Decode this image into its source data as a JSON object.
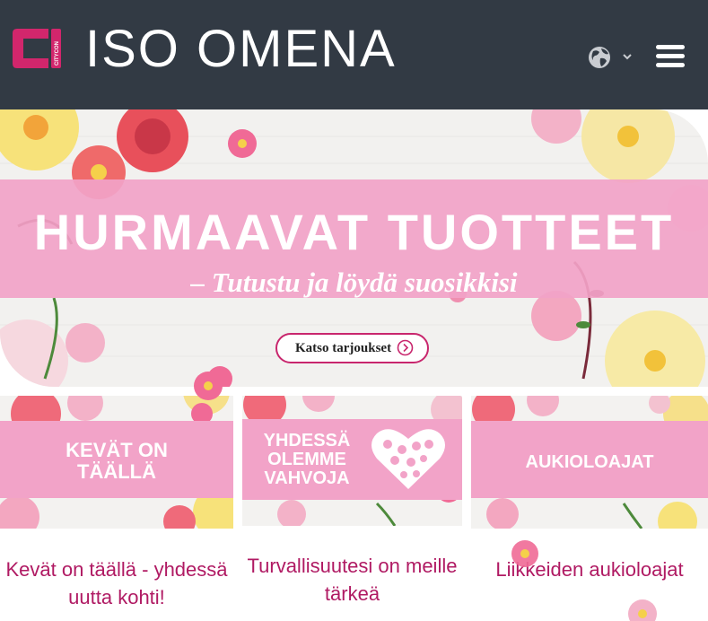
{
  "header": {
    "brand_name": "ISO OMENA",
    "logo_text": "CITYCON",
    "background": "#323a44",
    "icons": {
      "language": "globe-icon",
      "language_caret": "chevron-down-icon",
      "menu": "hamburger-icon"
    }
  },
  "hero": {
    "title": "HURMAAVAT TUOTTEET",
    "subtitle": "– Tutustu ja löydä suosikkisi",
    "cta_label": "Katso tarjoukset",
    "band_color": "#f2a3c8",
    "cta_border": "#c8266d"
  },
  "cards": [
    {
      "banner": "KEVÄT ON TÄÄLLÄ",
      "caption": "Kevät on täällä - yhdessä uutta kohti!"
    },
    {
      "banner": "YHDESSÄ OLEMME VAHVOJA",
      "caption": "Turvallisuutesi on meille tärkeä"
    },
    {
      "banner": "AUKIOLOAJAT",
      "caption": "Liikkeiden aukioloajat"
    }
  ],
  "colors": {
    "accent": "#b01a63",
    "pink": "#f2a3c8",
    "logo": "#d2266c"
  }
}
